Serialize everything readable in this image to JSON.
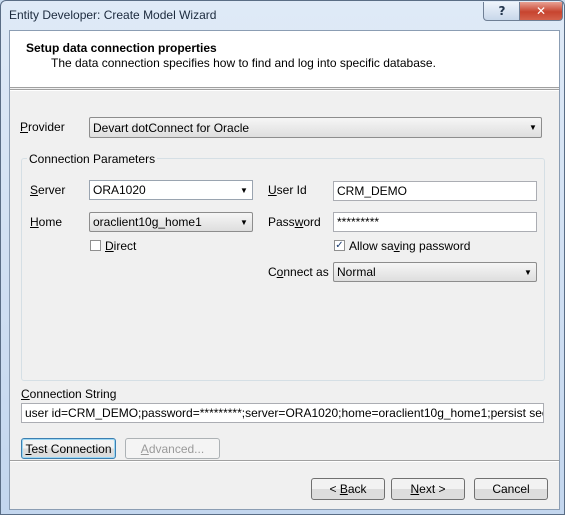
{
  "window": {
    "title": "Entity Developer: Create Model Wizard",
    "help_glyph": "?",
    "close_glyph": "✕"
  },
  "header": {
    "title": "Setup data connection properties",
    "description": "The data connection specifies how to find and log into specific database."
  },
  "provider": {
    "label_accel": "P",
    "label_rest": "rovider",
    "value": "Devart dotConnect for Oracle"
  },
  "connection_params": {
    "title": "Connection Parameters",
    "server": {
      "label_accel": "S",
      "label_rest": "erver",
      "value": "ORA1020"
    },
    "home": {
      "label_accel": "H",
      "label_rest": "ome",
      "value": "oraclient10g_home1"
    },
    "direct": {
      "label_accel": "D",
      "label_rest": "irect",
      "checked": false
    },
    "user_id": {
      "label_pre": "",
      "label_accel": "U",
      "label_rest": "ser Id",
      "value": "CRM_DEMO"
    },
    "password": {
      "label_pre": "Pass",
      "label_accel": "w",
      "label_rest": "ord",
      "value": "*********"
    },
    "allow_saving": {
      "label_pre": "Allow sa",
      "label_accel": "v",
      "label_rest": "ing password",
      "checked": true,
      "check_glyph": "✓"
    },
    "connect_as": {
      "label_pre": "C",
      "label_accel": "o",
      "label_rest": "nnect as",
      "value": "Normal"
    }
  },
  "connection_string": {
    "label_pre": "",
    "label_accel": "C",
    "label_rest": "onnection String",
    "value": "user id=CRM_DEMO;password=*********;server=ORA1020;home=oraclient10g_home1;persist security inf"
  },
  "buttons": {
    "test_connection": {
      "label_accel": "T",
      "label_rest": "est Connection"
    },
    "advanced": {
      "label_accel": "A",
      "label_rest": "dvanced..."
    },
    "back": {
      "label_pre": "< ",
      "label_accel": "B",
      "label_rest": "ack"
    },
    "next": {
      "label_pre": "",
      "label_accel": "N",
      "label_rest": "ext >"
    },
    "cancel": {
      "label": "Cancel"
    }
  },
  "icons": {
    "dropdown": "chevron-down-icon",
    "check": "checkmark-icon"
  },
  "colors": {
    "titlebar": "#c9dcf0",
    "close": "#c7442f",
    "panel": "#f0f0f0"
  }
}
